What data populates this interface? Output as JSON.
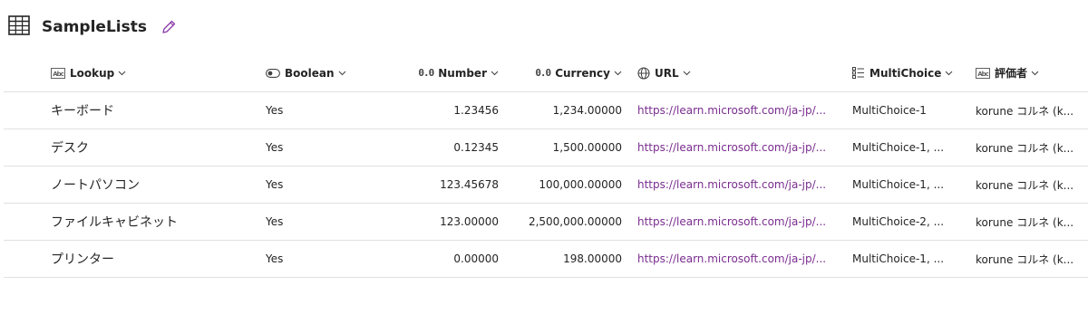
{
  "header": {
    "title": "SampleLists"
  },
  "columns": [
    {
      "label": "Lookup",
      "icon": "text-field-icon",
      "icon_text": "Abc"
    },
    {
      "label": "Boolean",
      "icon": "toggle-icon"
    },
    {
      "label": "Number",
      "icon": "number-icon",
      "icon_text": "0.0"
    },
    {
      "label": "Currency",
      "icon": "number-icon",
      "icon_text": "0.0"
    },
    {
      "label": "URL",
      "icon": "globe-icon"
    },
    {
      "label": "MultiChoice",
      "icon": "multichoice-list-icon"
    },
    {
      "label": "評価者",
      "icon": "text-field-icon",
      "icon_text": "Abc"
    }
  ],
  "rows": [
    {
      "lookup": "キーボード",
      "boolean": "Yes",
      "number": "1.23456",
      "currency": "1,234.00000",
      "url": "https://learn.microsoft.com/ja-jp/...",
      "multichoice": "MultiChoice-1",
      "evaluator": "korune コルネ (k..."
    },
    {
      "lookup": "デスク",
      "boolean": "Yes",
      "number": "0.12345",
      "currency": "1,500.00000",
      "url": "https://learn.microsoft.com/ja-jp/...",
      "multichoice": "MultiChoice-1, ...",
      "evaluator": "korune コルネ (k..."
    },
    {
      "lookup": "ノートパソコン",
      "boolean": "Yes",
      "number": "123.45678",
      "currency": "100,000.00000",
      "url": "https://learn.microsoft.com/ja-jp/...",
      "multichoice": "MultiChoice-1, ...",
      "evaluator": "korune コルネ (k..."
    },
    {
      "lookup": "ファイルキャビネット",
      "boolean": "Yes",
      "number": "123.00000",
      "currency": "2,500,000.00000",
      "url": "https://learn.microsoft.com/ja-jp/...",
      "multichoice": "MultiChoice-2, ...",
      "evaluator": "korune コルネ (k..."
    },
    {
      "lookup": "プリンター",
      "boolean": "Yes",
      "number": "0.00000",
      "currency": "198.00000",
      "url": "https://learn.microsoft.com/ja-jp/...",
      "multichoice": "MultiChoice-1, ...",
      "evaluator": "korune コルネ (k..."
    }
  ],
  "colors": {
    "link": "#7a2d8f",
    "edit_icon": "#8a3aa8",
    "divider": "#e1e1e1",
    "text": "#242424"
  }
}
